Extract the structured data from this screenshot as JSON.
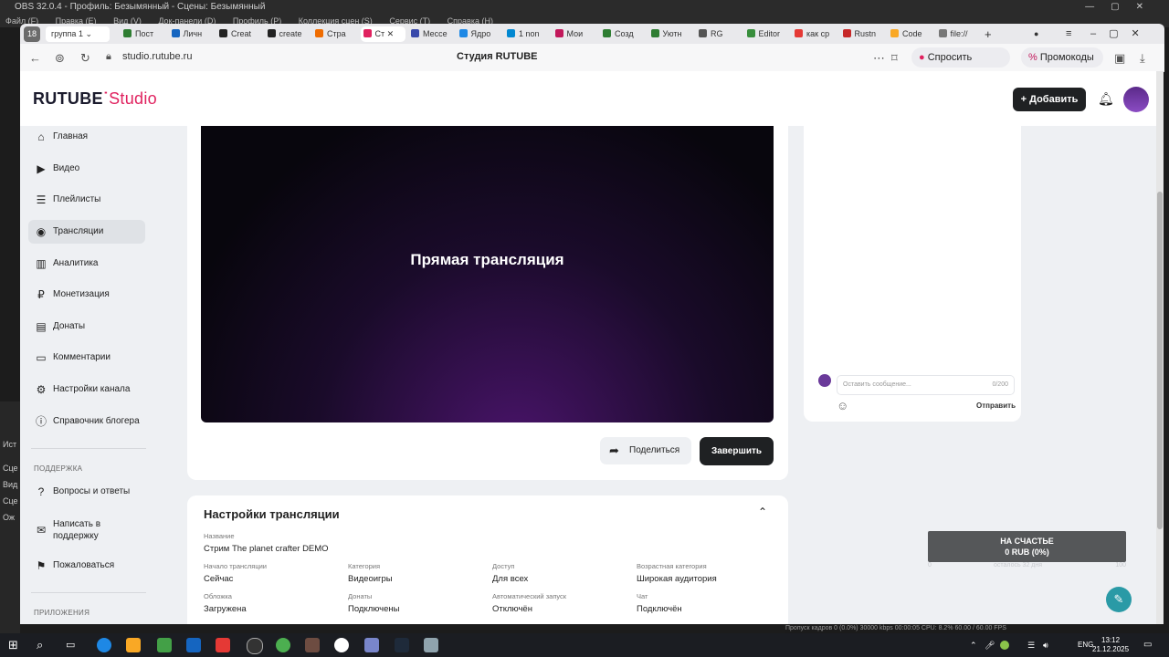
{
  "obs": {
    "title": "OBS 32.0.4 - Профиль: Безымянный - Сцены: Безымянный",
    "menu": [
      "Файл (F)",
      "Правка (E)",
      "Вид (V)",
      "Док-панели (D)",
      "Профиль (P)",
      "Коллекция сцен (S)",
      "Сервис (T)",
      "Справка (H)"
    ],
    "left_labels": [
      "Ист",
      "Сце",
      "Вид",
      "Сце",
      "Ож"
    ],
    "status": "Пропуск кадров 0 (0.0%)   30000 kbps   00:00:05   CPU: 8.2%   60.00 / 60.00 FPS"
  },
  "browser": {
    "tab_group_count": "18",
    "tab_group_label": "группа 1",
    "tabs": [
      {
        "label": "Пост",
        "color": "#2e7d32"
      },
      {
        "label": "Личн",
        "color": "#1565c0"
      },
      {
        "label": "Creat",
        "color": "#222222"
      },
      {
        "label": "create",
        "color": "#222222"
      },
      {
        "label": "Стра",
        "color": "#ef6c00"
      },
      {
        "label": "Ст",
        "color": "#e0225f"
      },
      {
        "label": "Мессе",
        "color": "#3949ab"
      },
      {
        "label": "Ядро",
        "color": "#1e88e5"
      },
      {
        "label": "1 non",
        "color": "#0288d1"
      },
      {
        "label": "Мои",
        "color": "#c2185b"
      },
      {
        "label": "Созд",
        "color": "#2e7d32"
      },
      {
        "label": "Уютн",
        "color": "#2e7d32"
      },
      {
        "label": "RG",
        "color": "#555555"
      },
      {
        "label": "Editor",
        "color": "#388e3c"
      },
      {
        "label": "как ср",
        "color": "#e53935"
      },
      {
        "label": "Rustn",
        "color": "#c62828"
      },
      {
        "label": "Code",
        "color": "#f9a825"
      },
      {
        "label": "file://",
        "color": "#777777"
      }
    ],
    "url": "studio.rutube.ru",
    "page_title": "Студия RUTUBE",
    "alice_label": "Спросить Алису AI",
    "promo_label": "Промокоды"
  },
  "header": {
    "logo_main": "RUTUBE",
    "logo_studio": "Studio",
    "add_label": "Добавить"
  },
  "sidebar": {
    "items": [
      {
        "label": "Главная",
        "icon": "⌂"
      },
      {
        "label": "Видео",
        "icon": "▶"
      },
      {
        "label": "Плейлисты",
        "icon": "☰"
      },
      {
        "label": "Трансляции",
        "icon": "◉"
      },
      {
        "label": "Аналитика",
        "icon": "▥"
      },
      {
        "label": "Монетизация",
        "icon": "₽"
      },
      {
        "label": "Донаты",
        "icon": "▤"
      },
      {
        "label": "Комментарии",
        "icon": "▭"
      },
      {
        "label": "Настройки канала",
        "icon": "⚙"
      },
      {
        "label": "Справочник блогера",
        "icon": "ⓘ"
      }
    ],
    "support_heading": "ПОДДЕРЖКА",
    "support_items": [
      {
        "label": "Вопросы и ответы",
        "icon": "?"
      },
      {
        "label": "Написать в поддержку",
        "icon": "✉"
      },
      {
        "label": "Пожаловаться",
        "icon": "⚑"
      }
    ],
    "apps_heading": "ПРИЛОЖЕНИЯ"
  },
  "player": {
    "title": "Прямая трансляция",
    "share_label": "Поделиться",
    "end_label": "Завершить"
  },
  "chat": {
    "placeholder": "Оставить сообщение...",
    "counter": "0/200",
    "send_label": "Отправить"
  },
  "settings": {
    "title": "Настройки трансляции",
    "name_label": "Название",
    "name_value": "Стрим The planet crafter DEMO",
    "fields": [
      {
        "label": "Начало трансляции",
        "value": "Сейчас"
      },
      {
        "label": "Категория",
        "value": "Видеоигры"
      },
      {
        "label": "Доступ",
        "value": "Для всех"
      },
      {
        "label": "Возрастная категория",
        "value": "Широкая аудитория"
      },
      {
        "label": "Обложка",
        "value": "Загружена"
      },
      {
        "label": "Донаты",
        "value": "Подключены"
      },
      {
        "label": "Автоматический запуск",
        "value": "Отключён"
      },
      {
        "label": "Чат",
        "value": "Подключён"
      }
    ]
  },
  "donate_widget": {
    "line1": "НА СЧАСТЬЕ",
    "line2": "0 RUB (0%)",
    "sub_left": "0",
    "sub_mid": "осталось 32 дня",
    "sub_right": "100"
  },
  "taskbar": {
    "lang": "ENG",
    "time": "13:12",
    "date": "21.12.2025"
  }
}
